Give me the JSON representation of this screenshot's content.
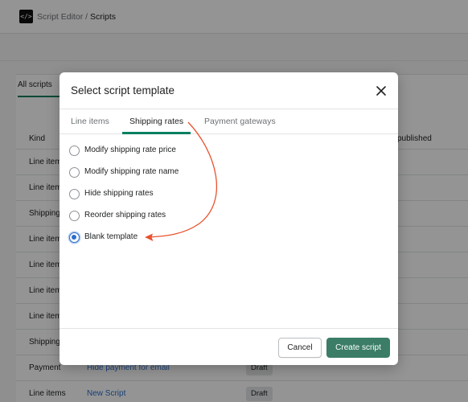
{
  "app": {
    "logo_icon": "</>",
    "breadcrumb_parent": "Script Editor",
    "breadcrumb_separator": " / ",
    "breadcrumb_current": "Scripts"
  },
  "background": {
    "tab_all": "All scripts",
    "col_kind": "Kind",
    "col_published": "published",
    "rows": [
      {
        "kind": "Line item"
      },
      {
        "kind": "Line item"
      },
      {
        "kind": "Shipping"
      },
      {
        "kind": "Line item"
      },
      {
        "kind": "Line item"
      },
      {
        "kind": "Line item"
      },
      {
        "kind": "Line item"
      },
      {
        "kind": "Shipping"
      },
      {
        "kind": "Payment",
        "name": "Hide payment for email",
        "status": "Draft"
      },
      {
        "kind": "Line items",
        "name": "New Script",
        "status": "Draft"
      }
    ]
  },
  "modal": {
    "title": "Select script template",
    "close_icon": "close-icon",
    "tabs": [
      "Line items",
      "Shipping rates",
      "Payment gateways"
    ],
    "active_tab": "Shipping rates",
    "options": [
      {
        "label": "Modify shipping rate price",
        "selected": false
      },
      {
        "label": "Modify shipping rate name",
        "selected": false
      },
      {
        "label": "Hide shipping rates",
        "selected": false
      },
      {
        "label": "Reorder shipping rates",
        "selected": false
      },
      {
        "label": "Blank template",
        "selected": true
      }
    ],
    "cancel_label": "Cancel",
    "create_label": "Create script"
  },
  "colors": {
    "accent": "#008060",
    "primary_button": "#3b7d67",
    "radio_selected": "#2c6ecb",
    "annotation_arrow": "#e8532f"
  }
}
